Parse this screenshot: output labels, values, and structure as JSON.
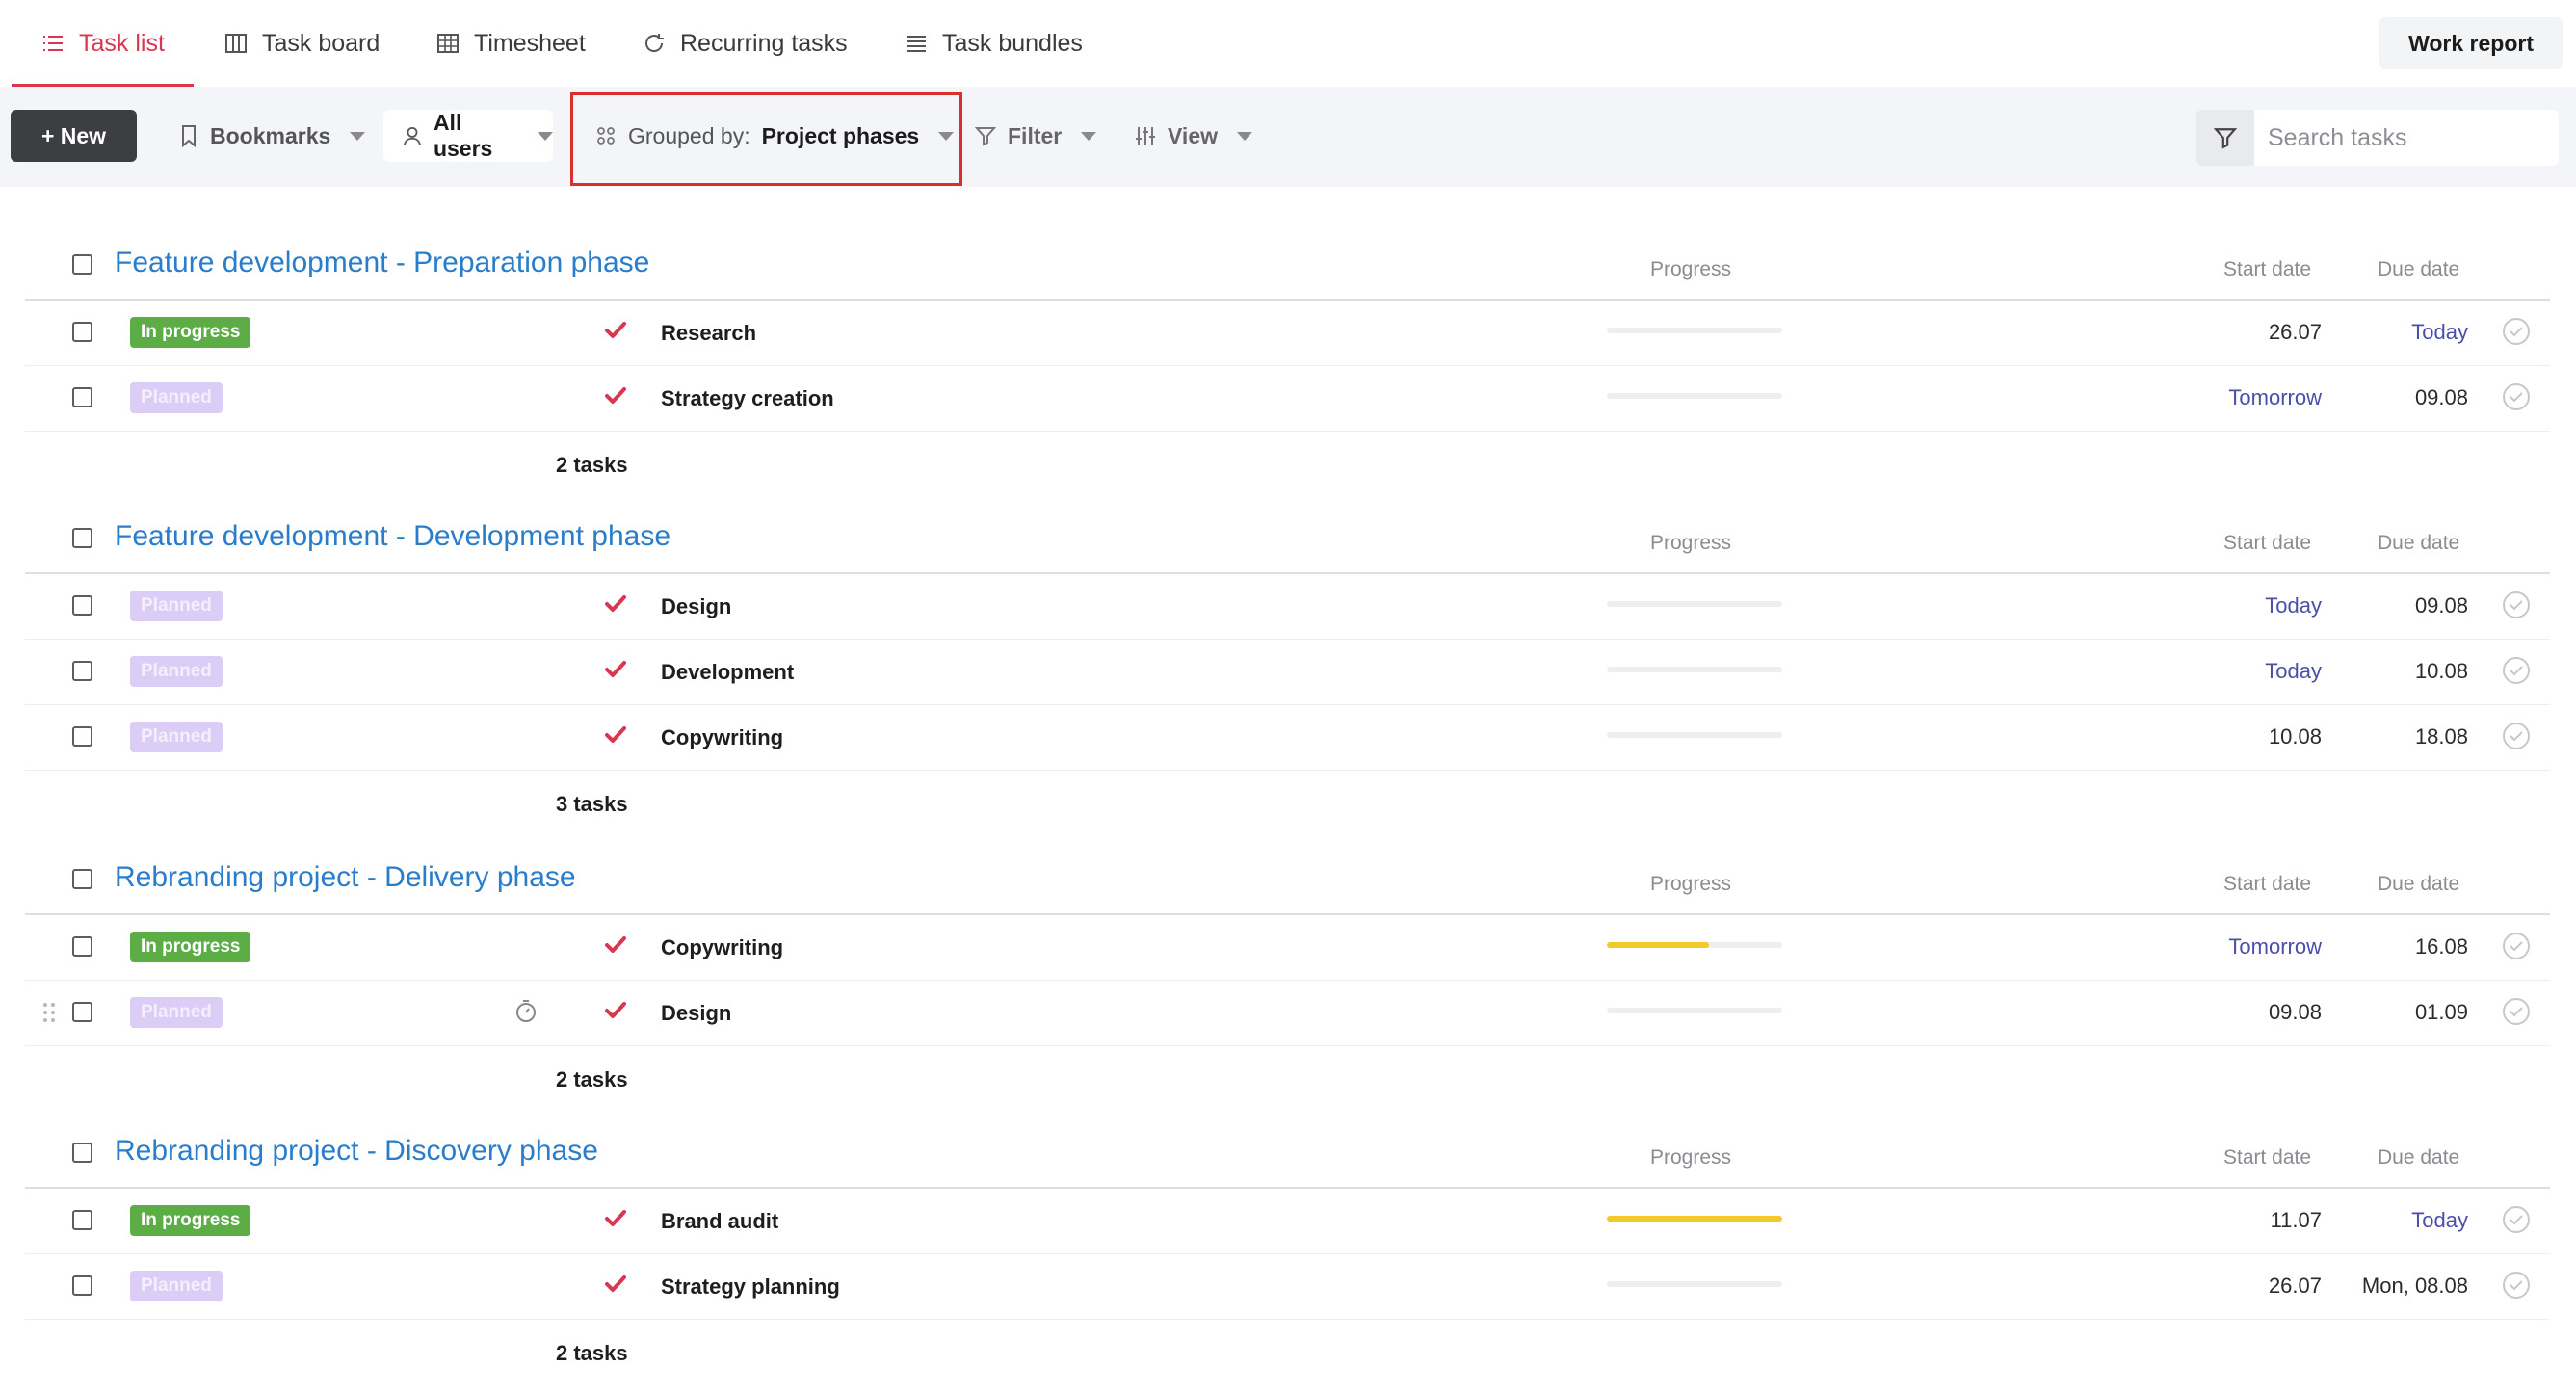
{
  "tabs": {
    "task_list": "Task list",
    "task_board": "Task board",
    "timesheet": "Timesheet",
    "recurring": "Recurring tasks",
    "bundles": "Task bundles"
  },
  "work_report": "Work report",
  "toolbar": {
    "new": "+ New",
    "bookmarks": "Bookmarks",
    "users": "All users",
    "grouped_prefix": "Grouped by:",
    "grouped_value": "Project phases",
    "filter": "Filter",
    "view": "View",
    "search_placeholder": "Search tasks"
  },
  "columns": {
    "progress": "Progress",
    "start": "Start date",
    "due": "Due date"
  },
  "groups": [
    {
      "title": "Feature development - Preparation phase",
      "count": "2 tasks",
      "tasks": [
        {
          "status": "In progress",
          "name": "Research",
          "progress": 0,
          "start": "26.07",
          "due": "Today"
        },
        {
          "status": "Planned",
          "name": "Strategy creation",
          "progress": 0,
          "start": "Tomorrow",
          "due": "09.08"
        }
      ]
    },
    {
      "title": "Feature development - Development phase",
      "count": "3 tasks",
      "tasks": [
        {
          "status": "Planned",
          "name": "Design",
          "progress": 0,
          "start": "Today",
          "due": "09.08"
        },
        {
          "status": "Planned",
          "name": "Development",
          "progress": 0,
          "start": "Today",
          "due": "10.08"
        },
        {
          "status": "Planned",
          "name": "Copywriting",
          "progress": 0,
          "start": "10.08",
          "due": "18.08"
        }
      ]
    },
    {
      "title": "Rebranding project - Delivery phase",
      "count": "2 tasks",
      "tasks": [
        {
          "status": "In progress",
          "name": "Copywriting",
          "progress": 0.58,
          "start": "Tomorrow",
          "due": "16.08"
        },
        {
          "status": "Planned",
          "name": "Design",
          "progress": 0,
          "start": "09.08",
          "due": "01.09"
        }
      ]
    },
    {
      "title": "Rebranding project - Discovery phase",
      "count": "2 tasks",
      "tasks": [
        {
          "status": "In progress",
          "name": "Brand audit",
          "progress": 1.0,
          "start": "11.07",
          "due": "Today"
        },
        {
          "status": "Planned",
          "name": "Strategy planning",
          "progress": 0,
          "start": "26.07",
          "due": "Mon, 08.08"
        }
      ]
    }
  ]
}
